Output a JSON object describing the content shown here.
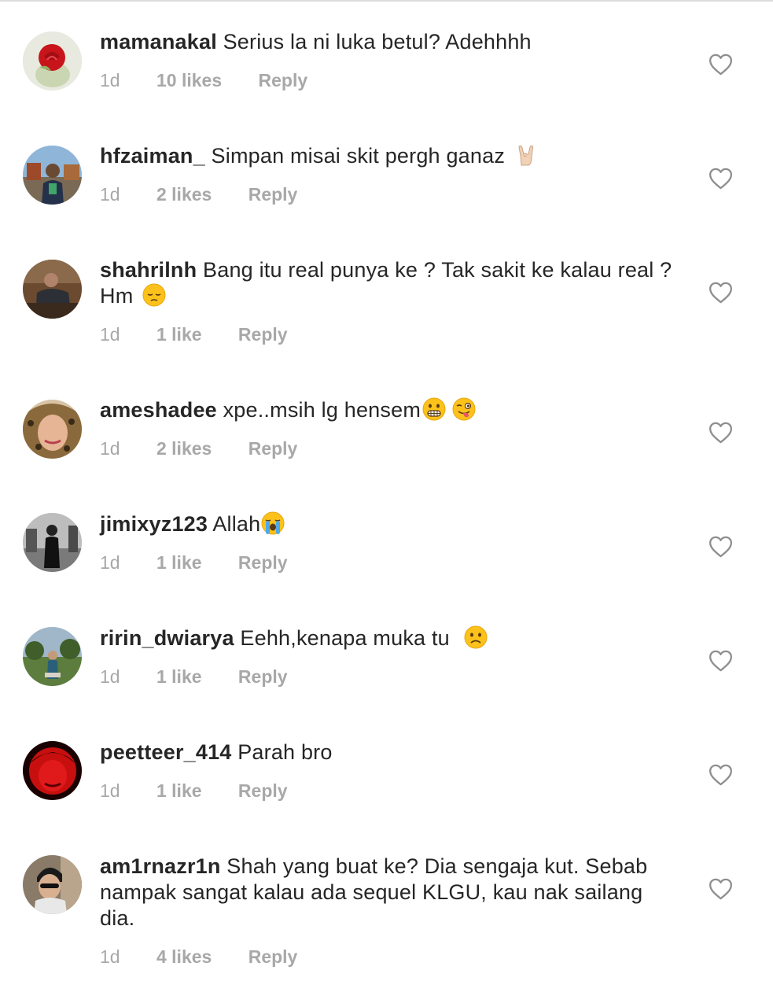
{
  "comments": [
    {
      "username": "mamanakal",
      "text": "Serius la ni luka betul? Adehhhh",
      "emoji": "",
      "time": "1d",
      "likes": "10 likes",
      "reply": "Reply"
    },
    {
      "username": "hfzaiman_",
      "text": "Simpan misai skit pergh ganaz ",
      "emoji": "rock-on-hand-emoji",
      "time": "1d",
      "likes": "2 likes",
      "reply": "Reply"
    },
    {
      "username": "shahrilnh",
      "text": "Bang itu real punya ke ? Tak sakit ke kalau real ? Hm ",
      "emoji": "pensive-face-emoji",
      "time": "1d",
      "likes": "1 like",
      "reply": "Reply"
    },
    {
      "username": "ameshadee",
      "text": "xpe..msih lg hensem",
      "emoji": "grimacing-face-emoji winking-tongue-face-emoji",
      "time": "1d",
      "likes": "2 likes",
      "reply": "Reply"
    },
    {
      "username": "jimixyz123",
      "text": "Allah",
      "emoji": "loudly-crying-face-emoji",
      "time": "1d",
      "likes": "1 like",
      "reply": "Reply"
    },
    {
      "username": "ririn_dwiarya",
      "text": "Eehh,kenapa muka tu ",
      "emoji": "frowning-face-emoji",
      "time": "1d",
      "likes": "1 like",
      "reply": "Reply"
    },
    {
      "username": "peetteer_414",
      "text": "Parah bro",
      "emoji": "",
      "time": "1d",
      "likes": "1 like",
      "reply": "Reply"
    },
    {
      "username": "am1rnazr1n",
      "text": "Shah yang buat ke? Dia sengaja kut. Sebab nampak sangat kalau ada sequel KLGU, kau nak sailang dia.",
      "emoji": "",
      "time": "1d",
      "likes": "4 likes",
      "reply": "Reply"
    }
  ],
  "colors": {
    "primary_text": "#262626",
    "secondary_text": "#a8a8a8",
    "border": "#dbdbdb",
    "heart_outline": "#8e8e8e"
  },
  "icons": {
    "like": "heart-outline-icon"
  }
}
